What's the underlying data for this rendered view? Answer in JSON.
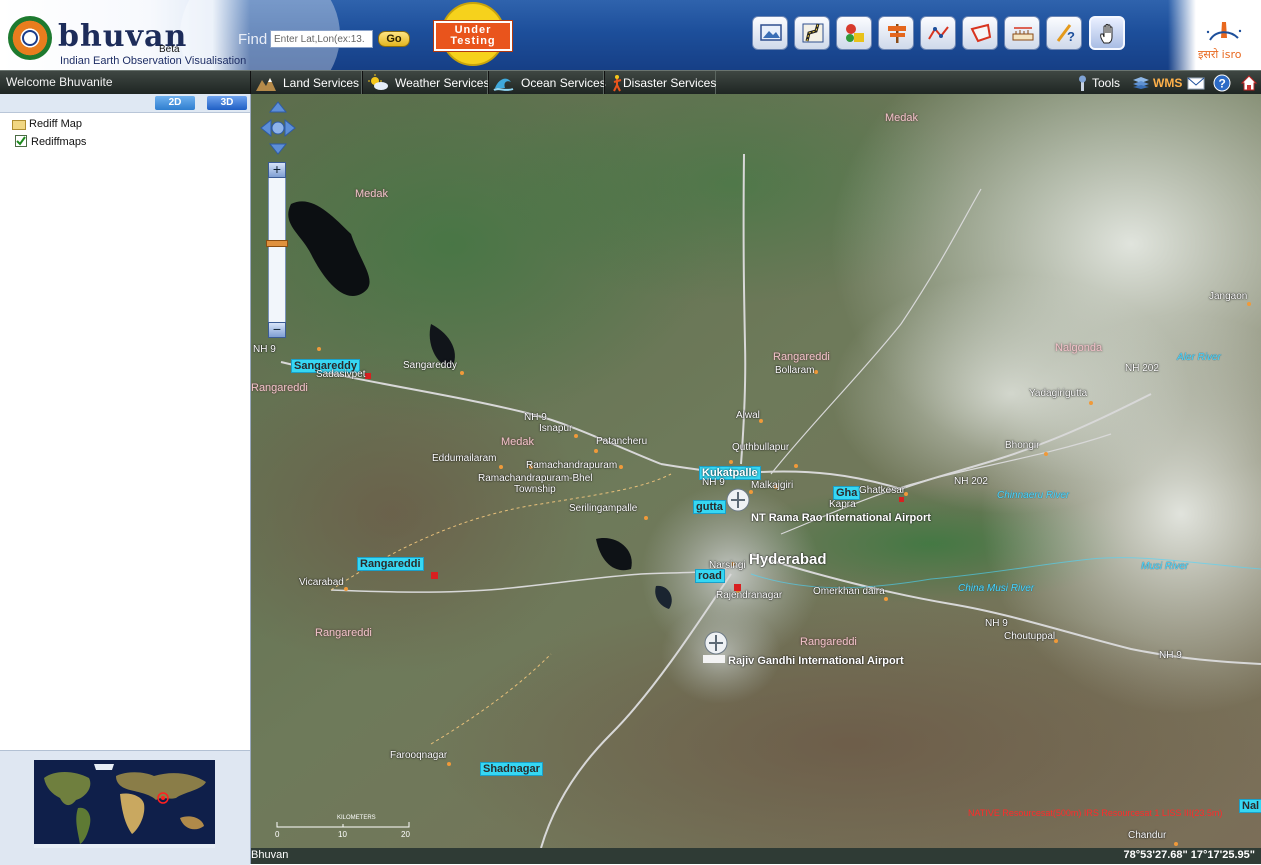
{
  "header": {
    "logo_text": "bhuvan",
    "beta_label": "Beta",
    "tagline": "Indian Earth Observation Visualisation",
    "find_label": "Find",
    "find_placeholder": "Enter Lat,Lon(ex:13.",
    "go_label": "Go",
    "badge_text": "Under\nTesting",
    "isro_text": "इसरो isro",
    "toolbar_icons": [
      "image-layer-icon",
      "route-icon",
      "shapes-icon",
      "signpost-icon",
      "polyline-icon",
      "polygon-icon",
      "distance-icon",
      "help-pointer-icon",
      "hand-pan-icon"
    ]
  },
  "nav": {
    "welcome": "Welcome Bhuvanite",
    "services": [
      {
        "label": "Land Services"
      },
      {
        "label": "Weather Services"
      },
      {
        "label": "Ocean Services"
      },
      {
        "label": "Disaster Services"
      }
    ],
    "tools_label": "Tools",
    "wms_label": "WMS"
  },
  "left_panel": {
    "btn_2d": "2D",
    "btn_3d": "3D",
    "folder_label": "Rediff Map",
    "checkbox_label": "Rediffmaps",
    "checkbox_checked": true
  },
  "map": {
    "labels": {
      "medak_ne": "Medak",
      "medak_nw": "Medak",
      "rangareddi_n": "Rangareddi",
      "bollaram": "Bollaram",
      "nalgonda": "Nalgonda",
      "jangaon": "Jangaon",
      "aler_river": "Aler River",
      "nh202_e": "NH 202",
      "yadagirigutta": "Yadagirigutta",
      "bhongir": "Bhongir",
      "nh202_m": "NH 202",
      "chinnaeru": "Chinnaeru River",
      "sangareddy_cyan": "Sangareddy",
      "sadasivpet": "Sadasivpet",
      "sangareddy": "Sangareddy",
      "rangareddi_w": "Rangareddi",
      "nh_w": "NH 9",
      "nh9_w2": "NH 9",
      "alwal": "Alwal",
      "isnapur": "Isnapur",
      "patancheru": "Patancheru",
      "medak_m": "Medak",
      "quthbullapur": "Quthbullapur",
      "eddumailaram": "Eddumailaram",
      "ramachandrapuram": "Ramachandrapuram",
      "kukatpalle": "Kukatpalle",
      "rcp_bhel": "Ramachandrapuram-Bhel",
      "township": "Township",
      "nh9_kuk": "NH 9",
      "malkajgiri": "Malkajgiri",
      "ghatkesar_cyan": "Gha",
      "ghatkesar": "Ghatkesar",
      "kapra": "Kapra",
      "serilingampalle": "Serilingampalle",
      "gutta_cyan": "gutta",
      "ntr_airport": "NT Rama Rao International Airport",
      "hyderabad": "Hyderabad",
      "narsingi": "Narsingi",
      "musi": "Musi River",
      "rangareddi_cyan": "Rangareddi",
      "road_cyan": "road",
      "rajendranagar": "Rajendranagar",
      "vicarabad": "Vicarabad",
      "omerkhan": "Omerkhan daira",
      "china_musi": "China Musi River",
      "rangareddi_sw": "Rangareddi",
      "nh9_e": "NH 9",
      "choutuppal": "Choutuppal",
      "nh9_far": "NH 9",
      "rangareddi_s": "Rangareddi",
      "rgi_airport": "Rajiv Gandhi International Airport",
      "farooqnagar": "Farooqnagar",
      "shadnagar": "Shadnagar",
      "credit": "NATIVE Resourcesat(500m) IRS Resourcesat 1 LISS III(23.5m)",
      "chandur": "Chandur",
      "nal_cyan": "Nal"
    },
    "scale": {
      "unit": "KILOMETERS",
      "ticks": [
        "0",
        "10",
        "20"
      ]
    },
    "zoom_level_fraction": 0.45
  },
  "status": {
    "left": "Bhuvan",
    "coords": "78°53'27.68\" 17°17'25.95\""
  }
}
